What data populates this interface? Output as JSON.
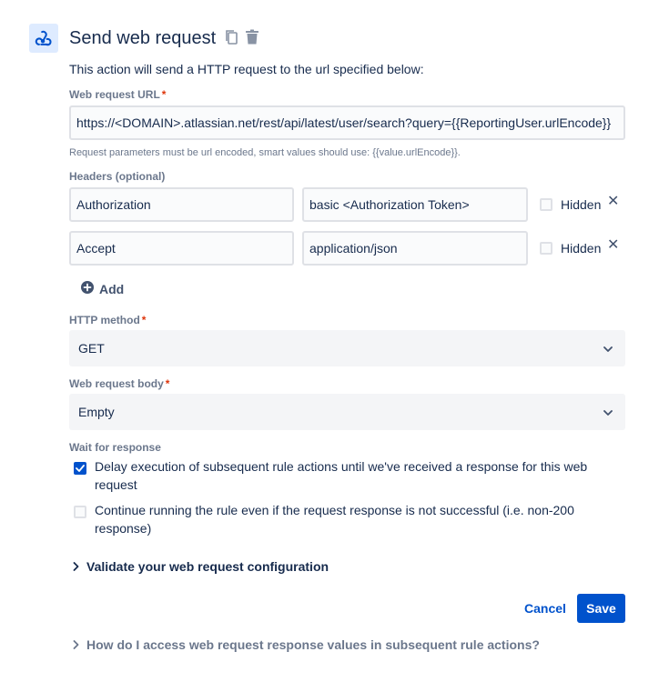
{
  "header": {
    "title": "Send web request",
    "icons": [
      "webhook-icon",
      "copy-icon",
      "trash-icon"
    ]
  },
  "description": "This action will send a HTTP request to the url specified below:",
  "url_field": {
    "label": "Web request URL",
    "required_mark": "*",
    "value": "https://<DOMAIN>.atlassian.net/rest/api/latest/user/search?query={{ReportingUser.urlEncode}}",
    "helper": "Request parameters must be url encoded, smart values should use: {{value.urlEncode}}."
  },
  "headers": {
    "label": "Headers (optional)",
    "rows": [
      {
        "name": "Authorization",
        "value": "basic <Authorization Token>",
        "hidden_label": "Hidden",
        "hidden": false
      },
      {
        "name": "Accept",
        "value": "application/json",
        "hidden_label": "Hidden",
        "hidden": false
      }
    ],
    "add_label": "Add"
  },
  "http_method": {
    "label": "HTTP method",
    "required_mark": "*",
    "value": "GET"
  },
  "body": {
    "label": "Web request body",
    "required_mark": "*",
    "value": "Empty"
  },
  "wait": {
    "label": "Wait for response",
    "options": [
      {
        "text": "Delay execution of subsequent rule actions until we've received a response for this web request",
        "checked": true
      },
      {
        "text": "Continue running the rule even if the request response is not successful (i.e. non-200 response)",
        "checked": false
      }
    ]
  },
  "validate_label": "Validate your web request configuration",
  "actions": {
    "cancel": "Cancel",
    "save": "Save"
  },
  "help_label": "How do I access web request response values in subsequent rule actions?",
  "colors": {
    "primary": "#0052cc",
    "required": "#de350b",
    "muted": "#6b778c"
  }
}
